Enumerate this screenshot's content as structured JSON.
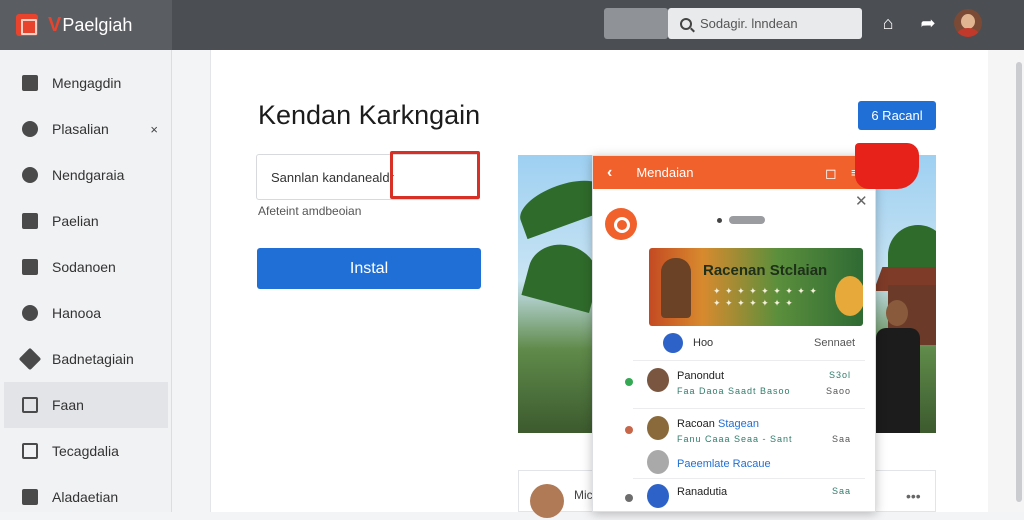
{
  "brand": {
    "v": "V",
    "name": "Paelgiah"
  },
  "search": {
    "text": "Sodagir. lnndean"
  },
  "sidebar": {
    "items": [
      {
        "label": "Mengagdin"
      },
      {
        "label": "Plasalian",
        "close": "×"
      },
      {
        "label": "Nendgaraia"
      },
      {
        "label": "Paelian"
      },
      {
        "label": "Sodanoen"
      },
      {
        "label": "Hanooa"
      },
      {
        "label": "Badnetagiain"
      },
      {
        "label": "Faan"
      },
      {
        "label": "Tecagdalia"
      },
      {
        "label": "Aladaetian"
      }
    ]
  },
  "main": {
    "title": "Kendan Karkngain",
    "install_top": "6 Racanl",
    "field_value": "Sannlan  kandanealdr",
    "field_hint": "Afeteint amdbeoian",
    "install_main": "Instal"
  },
  "chat": {
    "title": "Mendaian",
    "banner_title": "Racenan Stclaian",
    "banner_sub": "✦ ✦ ✦ ✦ ✦ ✦ ✦ ✦ ✦",
    "banner_sub2": "✦ ✦ ✦ ✦ ✦ ✦ ✦",
    "meta_left": "Hoo",
    "meta_right": "Sennaet",
    "messages": [
      {
        "name": "Panondut",
        "sub": "Faa  Daoa  Saadt  Basoo",
        "time": "S3ol",
        "time2": "Saoo"
      },
      {
        "name": "Racoan",
        "name_accent": "Stagean",
        "sub": "Fanu  Caaa  Seaa  -  Sant",
        "time": "Saa"
      },
      {
        "name": "",
        "name_accent": "Paeemlate Racaue",
        "sub": "",
        "time": ""
      },
      {
        "name": "Ranadutia",
        "sub": "",
        "time": "Saa"
      }
    ]
  },
  "bottom_card": {
    "label": "Mic",
    "more": "•••"
  },
  "colors": {
    "accent": "#f0612b",
    "primary": "#1f6fd6",
    "alert": "#d93025",
    "topbar": "#4b4e53"
  },
  "icons": [
    "home-icon",
    "share-icon",
    "search-icon",
    "chevron-left-icon",
    "close-icon",
    "chat-bubble-icon",
    "menu-icon"
  ]
}
